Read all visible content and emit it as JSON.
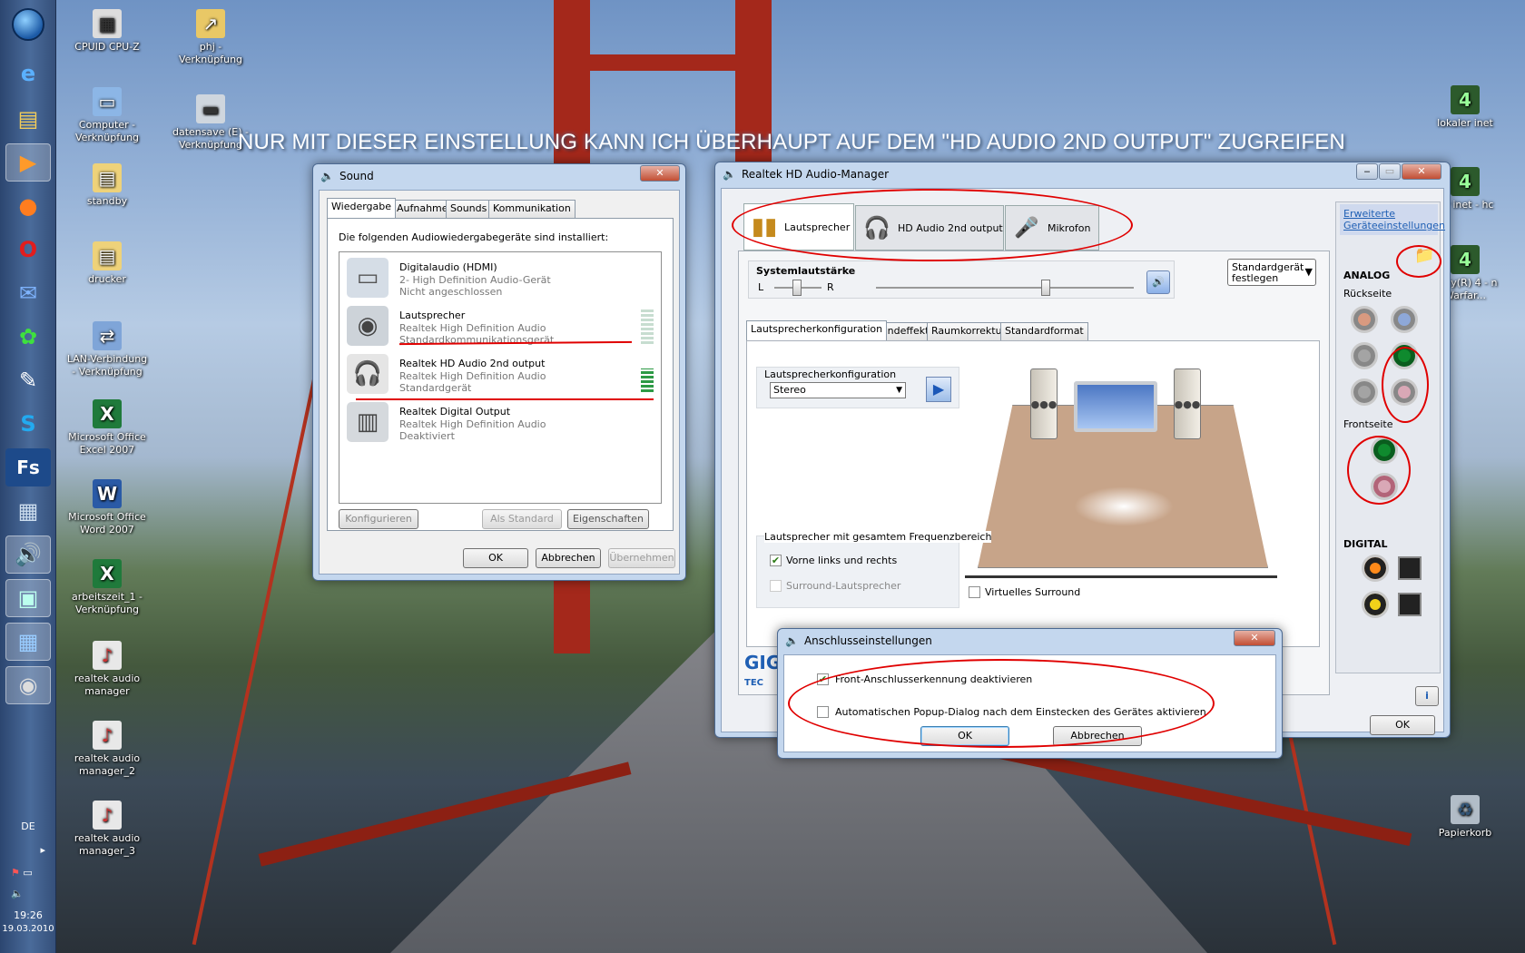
{
  "banner": "NUR MIT DIESER EINSTELLUNG KANN ICH ÜBERHAUPT  AUF DEM \"HD AUDIO 2ND OUTPUT\" ZUGREIFEN",
  "taskbar": {
    "lang": "DE",
    "time": "19:26",
    "date": "19.03.2010"
  },
  "desktop_icons": [
    {
      "label": "CPUID CPU-Z",
      "icon": "cpuz-icon"
    },
    {
      "label": "phj - Verknüpfung",
      "icon": "folder-shortcut-icon"
    },
    {
      "label": "Computer - Verknüpfung",
      "icon": "computer-icon"
    },
    {
      "label": "datensave (E) - Verknüpfung",
      "icon": "drive-icon"
    },
    {
      "label": "standby",
      "icon": "folder-icon"
    },
    {
      "label": "drucker",
      "icon": "folder-icon"
    },
    {
      "label": "LAN-Verbindung - Verknüpfung",
      "icon": "network-icon"
    },
    {
      "label": "Microsoft Office Excel 2007",
      "icon": "excel-icon"
    },
    {
      "label": "Microsoft Office Word 2007",
      "icon": "word-icon"
    },
    {
      "label": "arbeitszeit_1 - Verknüpfung",
      "icon": "excel-icon"
    },
    {
      "label": "realtek audio manager",
      "icon": "realtek-icon"
    },
    {
      "label": "realtek audio manager_2",
      "icon": "realtek-icon"
    },
    {
      "label": "realtek audio manager_3",
      "icon": "realtek-icon"
    },
    {
      "label": "lokaler inet",
      "icon": "game-icon"
    },
    {
      "label": "ler inet - hc",
      "icon": "game-icon"
    },
    {
      "label": "Duty(R) 4 - n Warfar...",
      "icon": "game-icon"
    },
    {
      "label": "Papierkorb",
      "icon": "recycle-bin-icon"
    }
  ],
  "sound": {
    "title": "Sound",
    "tabs": [
      "Wiedergabe",
      "Aufnahme",
      "Sounds",
      "Kommunikation"
    ],
    "intro": "Die folgenden Audiowiedergabegeräte sind installiert:",
    "devices": [
      {
        "name": "Digitalaudio (HDMI)",
        "line1": "2- High Definition Audio-Gerät",
        "line2": "Nicht angeschlossen"
      },
      {
        "name": "Lautsprecher",
        "line1": "Realtek High Definition Audio",
        "line2": "Standardkommunikationsgerät"
      },
      {
        "name": "Realtek HD Audio 2nd output",
        "line1": "Realtek High Definition Audio",
        "line2": "Standardgerät"
      },
      {
        "name": "Realtek Digital Output",
        "line1": "Realtek High Definition Audio",
        "line2": "Deaktiviert"
      }
    ],
    "btn_configure": "Konfigurieren",
    "btn_default": "Als Standard",
    "btn_props": "Eigenschaften",
    "btn_ok": "OK",
    "btn_cancel": "Abbrechen",
    "btn_apply": "Übernehmen"
  },
  "realtek": {
    "title": "Realtek HD Audio-Manager",
    "tabs": [
      "Lautsprecher",
      "HD Audio 2nd output",
      "Mikrofon"
    ],
    "adv_link": "Erweiterte Geräteeinstellungen",
    "volume_label": "Systemlautstärke",
    "left": "L",
    "right": "R",
    "default_btn": "Standardgerät festlegen",
    "subtabs": [
      "Lautsprecherkonfiguration",
      "Soundeffekt",
      "Raumkorrektur",
      "Standardformat"
    ],
    "config_label": "Lautsprecherkonfiguration",
    "config_value": "Stereo",
    "fullrange_label": "Lautsprecher mit gesamtem Frequenzbereich",
    "front_lr": "Vorne links und rechts",
    "surround": "Surround-Lautsprecher",
    "virtual_surround": "Virtuelles Surround",
    "analog": "ANALOG",
    "back": "Rückseite",
    "front": "Frontseite",
    "digital": "DIGITAL",
    "logo": "GIG",
    "logo2": "TEC",
    "ok": "OK"
  },
  "connector": {
    "title": "Anschlusseinstellungen",
    "opt1": "Front-Anschlusserkennung deaktivieren",
    "opt2": "Automatischen Popup-Dialog nach dem Einstecken des Gerätes aktivieren",
    "ok": "OK",
    "cancel": "Abbrechen"
  },
  "colors": {
    "annotation": "#e00000",
    "accent": "#1f5fb4"
  }
}
